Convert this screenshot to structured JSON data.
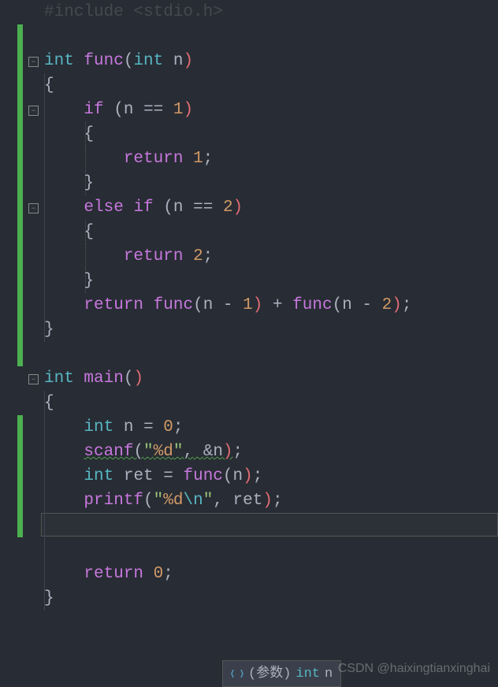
{
  "include": "#include <stdio.h>",
  "lines": {
    "l1_int": "int",
    "l1_func": "func",
    "l1_lp": "(",
    "l1_int2": "int",
    "l1_n": "n",
    "l1_rp": ")",
    "l2_brace": "{",
    "l3_if": "if",
    "l3_lp": "(",
    "l3_n": "n",
    "l3_eq": "==",
    "l3_1": "1",
    "l3_rp": ")",
    "l4_brace": "{",
    "l5_ret": "return",
    "l5_1": "1",
    "l5_semi": ";",
    "l6_brace": "}",
    "l7_else": "else",
    "l7_if": "if",
    "l7_lp": "(",
    "l7_n": "n",
    "l7_eq": "==",
    "l7_2": "2",
    "l7_rp": ")",
    "l8_brace": "{",
    "l9_ret": "return",
    "l9_2": "2",
    "l9_semi": ";",
    "l10_brace": "}",
    "l11_ret": "return",
    "l11_func": "func",
    "l11_lp1": "(",
    "l11_n1": "n",
    "l11_m1": "-",
    "l11_1": "1",
    "l11_rp1": ")",
    "l11_plus": "+",
    "l11_func2": "func",
    "l11_lp2": "(",
    "l11_n2": "n",
    "l11_m2": "-",
    "l11_2": "2",
    "l11_rp2": ")",
    "l11_semi": ";",
    "l12_brace": "}",
    "m1_int": "int",
    "m1_main": "main",
    "m1_lp": "(",
    "m1_rp": ")",
    "m2_brace": "{",
    "m3_int": "int",
    "m3_n": "n",
    "m3_eq": "=",
    "m3_0": "0",
    "m3_semi": ";",
    "m4_scanf": "scanf",
    "m4_lp": "(",
    "m4_str1": "\"",
    "m4_fmt": "%d",
    "m4_str2": "\"",
    "m4_c": ",",
    "m4_amp": "&",
    "m4_n": "n",
    "m4_rp": ")",
    "m4_semi": ";",
    "m5_int": "int",
    "m5_ret": "ret",
    "m5_eq": "=",
    "m5_func": "func",
    "m5_lp": "(",
    "m5_n": "n",
    "m5_rp": ")",
    "m5_semi": ";",
    "m6_printf": "printf",
    "m6_lp": "(",
    "m6_q1": "\"",
    "m6_fmt": "%d",
    "m6_esc": "\\n",
    "m6_q2": "\"",
    "m6_c": ",",
    "m6_ret": "ret",
    "m6_rp": ")",
    "m6_semi": ";",
    "m8_ret": "return",
    "m8_0": "0",
    "m8_semi": ";",
    "m9_brace": "}"
  },
  "tooltip": {
    "label": "(参数)",
    "type": "int",
    "name": "n"
  },
  "watermark": "CSDN @haixingtianxinghai"
}
